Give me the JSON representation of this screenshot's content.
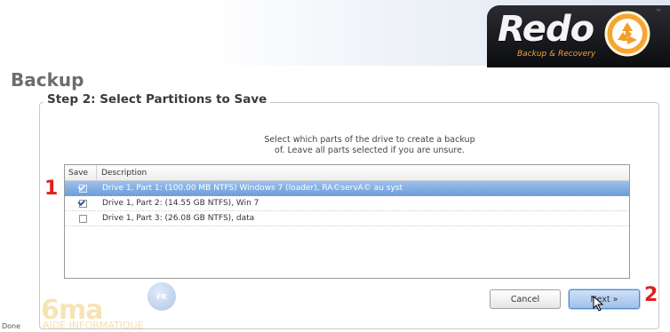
{
  "brand": {
    "logo_word": "Redo",
    "logo_tagline": "Backup & Recovery",
    "logo_tm": "™"
  },
  "page": {
    "title": "Backup",
    "step_title": "Step 2: Select Partitions to Save",
    "instructions_line1": "Select which parts of the drive to create a backup",
    "instructions_line2": "of. Leave all parts selected if you are unsure."
  },
  "table": {
    "columns": [
      "Save",
      "Description"
    ],
    "rows": [
      {
        "checked": true,
        "selected": true,
        "description": "Drive 1, Part 1: (100.00 MB NTFS) Windows 7 (loader), RÃ©servÃ© au syst"
      },
      {
        "checked": true,
        "selected": false,
        "description": "Drive 1, Part 2: (14.55 GB NTFS), Win 7"
      },
      {
        "checked": false,
        "selected": false,
        "description": "Drive 1, Part 3: (26.08 GB NTFS), data"
      }
    ]
  },
  "buttons": {
    "cancel": "Cancel",
    "next": "Next »"
  },
  "annotations": {
    "marker_1": "1",
    "marker_2": "2"
  },
  "watermark": {
    "word": "6ma",
    "badge": "FR",
    "subtitle": "AIDE INFORMATIQUE"
  },
  "status": {
    "text": "Done"
  },
  "colors": {
    "selection": "#7aa8df",
    "annotation": "#e02020",
    "logo_accent": "#f2a23a"
  }
}
